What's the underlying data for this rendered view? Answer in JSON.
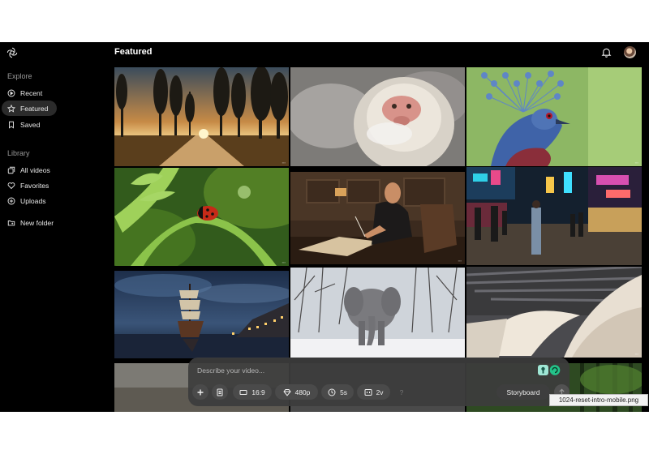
{
  "app": {
    "logo_icon": "openai-logo-icon"
  },
  "sidebar": {
    "explore_title": "Explore",
    "explore_items": [
      {
        "label": "Recent",
        "icon": "circle-play-icon"
      },
      {
        "label": "Featured",
        "icon": "star-icon"
      },
      {
        "label": "Saved",
        "icon": "bookmark-icon"
      }
    ],
    "library_title": "Library",
    "library_items": [
      {
        "label": "All videos",
        "icon": "stacked-squares-icon"
      },
      {
        "label": "Favorites",
        "icon": "heart-icon"
      },
      {
        "label": "Uploads",
        "icon": "plus-circle-icon"
      }
    ],
    "new_folder": {
      "label": "New folder",
      "icon": "folder-plus-icon"
    }
  },
  "header": {
    "title": "Featured",
    "notification_icon": "bell-icon",
    "avatar_icon": "user-avatar"
  },
  "grid": {
    "tiles": [
      {
        "subject": "tree-lined country road at sunset"
      },
      {
        "subject": "macaque in steam"
      },
      {
        "subject": "victoria crowned pigeon"
      },
      {
        "subject": "ladybug on grass blade"
      },
      {
        "subject": "man writing at desk"
      },
      {
        "subject": "neon street market at night"
      },
      {
        "subject": "sailing ship at dusk harbor"
      },
      {
        "subject": "elephant in snowy forest"
      },
      {
        "subject": "curved white architecture"
      }
    ]
  },
  "composer": {
    "placeholder": "Describe your video...",
    "add_icon": "plus-icon",
    "storyboard_icon": "document-icon",
    "aspect_ratio": "16:9",
    "resolution": "480p",
    "duration": "5s",
    "variations": "2v",
    "help": "?",
    "storyboard_label": "Storyboard",
    "send_icon": "arrow-up-icon"
  },
  "tooltip": {
    "text": "1024-reset-intro-mobile.png"
  }
}
